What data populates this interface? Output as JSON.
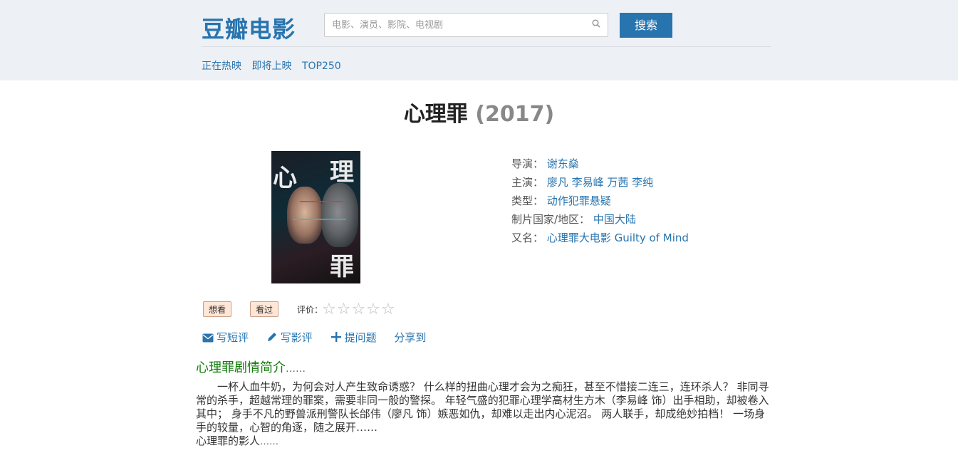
{
  "header": {
    "logo": "豆瓣电影",
    "search": {
      "placeholder": "电影、演员、影院、电视剧",
      "value": ""
    },
    "search_button": "搜索",
    "nav": [
      "正在热映",
      "即将上映",
      "TOP250"
    ]
  },
  "movie": {
    "title": "心理罪",
    "year": "(2017)",
    "poster": {
      "chars": [
        "心",
        "理",
        "罪"
      ]
    },
    "info": [
      {
        "label": "导演：",
        "value": "谢东燊"
      },
      {
        "label": "主演：",
        "value": "廖凡 李易峰 万茜 李纯"
      },
      {
        "label": "类型：",
        "value": "动作犯罪悬疑"
      },
      {
        "label": "制片国家/地区：",
        "value": "中国大陆"
      },
      {
        "label": "又名：",
        "value": "心理罪大电影 Guilty of Mind"
      }
    ]
  },
  "user_actions": {
    "want": "想看",
    "seen": "看过",
    "rating_label": "评价：",
    "stars": "☆☆☆☆☆"
  },
  "action_links": [
    {
      "icon": "envelope-icon",
      "label": "写短评"
    },
    {
      "icon": "pencil-icon",
      "label": "写影评"
    },
    {
      "icon": "plus-icon",
      "label": "提问题"
    },
    {
      "icon": "",
      "label": "分享到"
    }
  ],
  "synopsis": {
    "title": "心理罪剧情简介",
    "title_suffix": "……",
    "text": "一杯人血牛奶，为何会对人产生致命诱惑？ 什么样的扭曲心理才会为之痴狂，甚至不惜接二连三，连环杀人？ 非同寻常的杀手，超越常理的罪案，需要非同一般的警探。 年轻气盛的犯罪心理学高材生方木（李易峰 饰）出手相助，却被卷入其中； 身手不凡的野兽派刑警队长邰伟（廖凡 饰）嫉恶如仇，却难以走出内心泥沼。 两人联手，却成绝妙拍档！ 一场身手的较量，心智的角逐，随之展开……"
  },
  "shadow_section": {
    "title": "心理罪的影人",
    "suffix": "……"
  }
}
